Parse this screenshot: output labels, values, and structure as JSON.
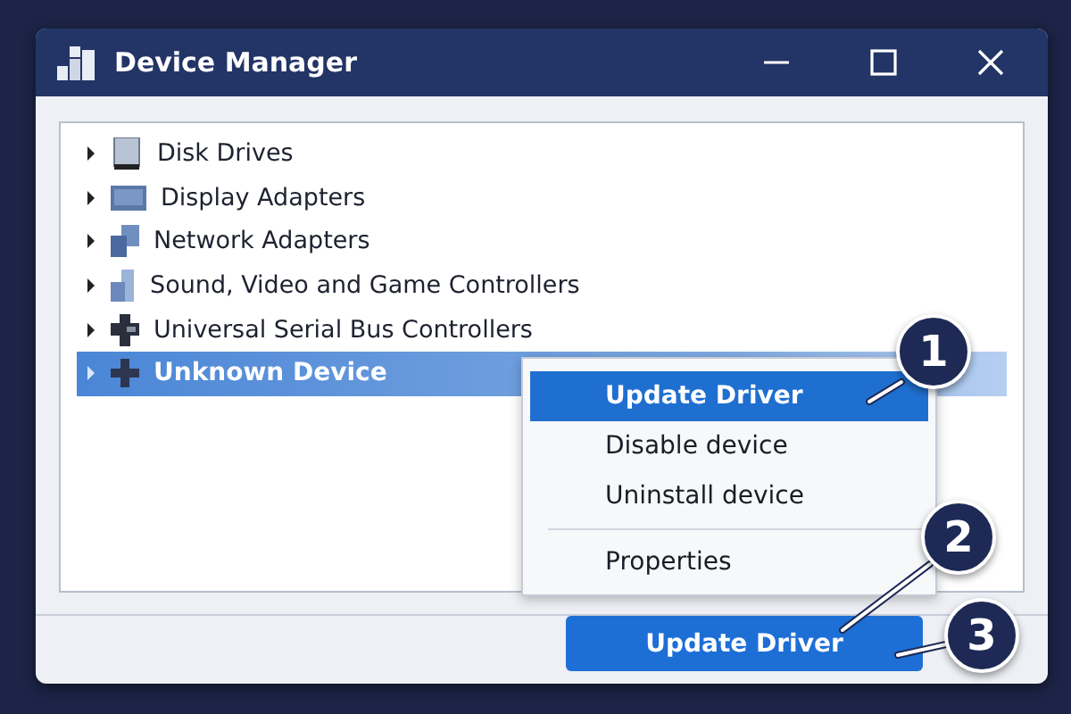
{
  "window": {
    "title": "Device Manager"
  },
  "tree": {
    "items": [
      {
        "label": "Disk Drives",
        "kind": "disk",
        "expanded": false,
        "selected": false
      },
      {
        "label": "Display Adapters",
        "kind": "display",
        "expanded": false,
        "selected": false
      },
      {
        "label": "Network Adapters",
        "kind": "network",
        "expanded": false,
        "selected": false
      },
      {
        "label": "Sound, Video and Game Controllers",
        "kind": "sound",
        "expanded": false,
        "selected": false
      },
      {
        "label": "Universal Serial Bus Controllers",
        "kind": "usb",
        "expanded": false,
        "selected": false
      },
      {
        "label": "Unknown Device",
        "kind": "unknown",
        "expanded": false,
        "selected": true
      }
    ]
  },
  "context_menu": {
    "items": [
      {
        "label": "Update Driver",
        "selected": true,
        "divider_before": false
      },
      {
        "label": "Disable device",
        "selected": false,
        "divider_before": false
      },
      {
        "label": "Uninstall device",
        "selected": false,
        "divider_before": false
      },
      {
        "label": "Properties",
        "selected": false,
        "divider_before": true
      }
    ]
  },
  "footer": {
    "button": "Update Driver"
  },
  "callouts": [
    "1",
    "2",
    "3"
  ]
}
